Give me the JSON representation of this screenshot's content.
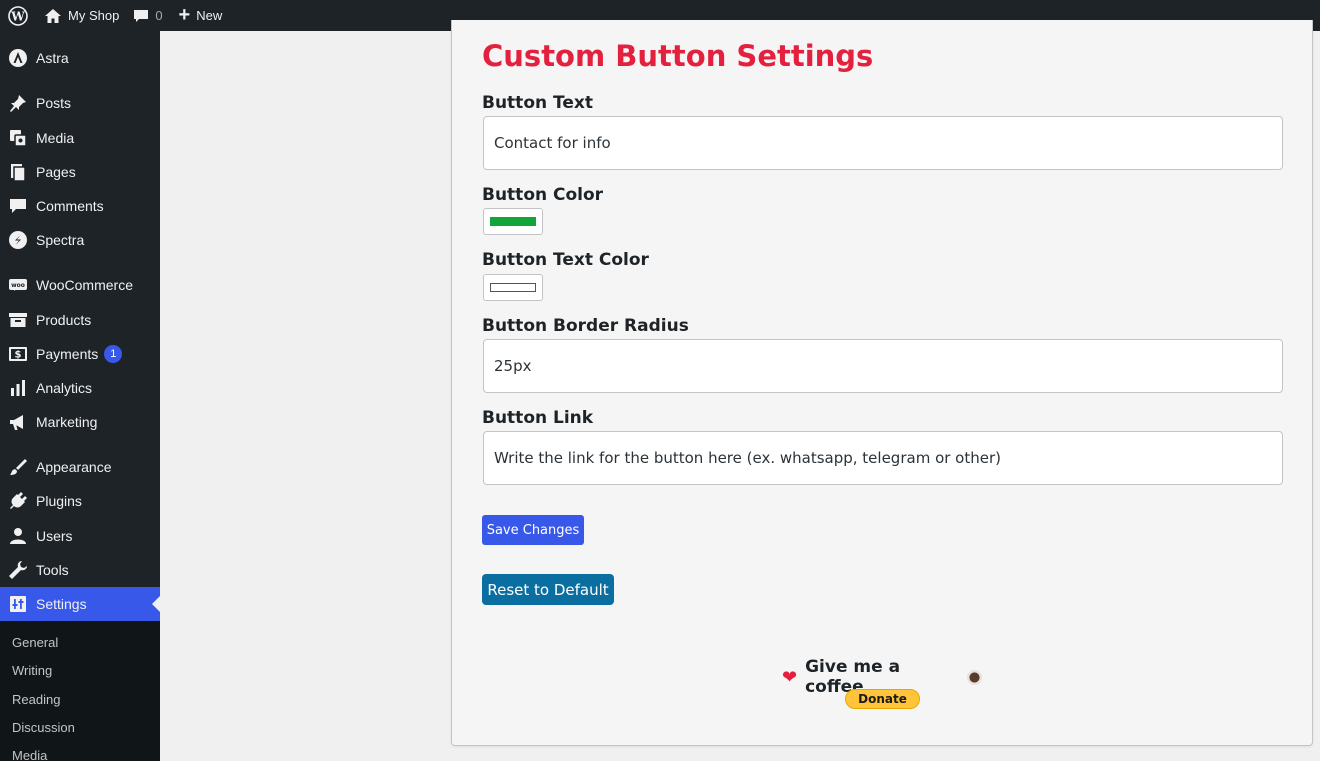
{
  "adminbar": {
    "site_name": "My Shop",
    "comments_count": "0",
    "new_label": "New"
  },
  "menu": {
    "items": [
      {
        "label": "Astra",
        "icon": "astra-icon"
      },
      {
        "label": "Posts",
        "icon": "pin-icon"
      },
      {
        "label": "Media",
        "icon": "media-icon"
      },
      {
        "label": "Pages",
        "icon": "pages-icon"
      },
      {
        "label": "Comments",
        "icon": "comment-icon"
      },
      {
        "label": "Spectra",
        "icon": "spectra-icon"
      },
      {
        "label": "WooCommerce",
        "icon": "woo-icon"
      },
      {
        "label": "Products",
        "icon": "archive-icon"
      },
      {
        "label": "Payments",
        "icon": "payments-icon",
        "badge": "1"
      },
      {
        "label": "Analytics",
        "icon": "chart-icon"
      },
      {
        "label": "Marketing",
        "icon": "megaphone-icon"
      },
      {
        "label": "Appearance",
        "icon": "brush-icon"
      },
      {
        "label": "Plugins",
        "icon": "plug-icon"
      },
      {
        "label": "Users",
        "icon": "user-icon"
      },
      {
        "label": "Tools",
        "icon": "wrench-icon"
      },
      {
        "label": "Settings",
        "icon": "settings-icon",
        "current": true
      }
    ],
    "submenu": [
      "General",
      "Writing",
      "Reading",
      "Discussion",
      "Media"
    ]
  },
  "page": {
    "title": "Custom Button Settings",
    "fields": {
      "button_text": {
        "label": "Button Text",
        "value": "Contact for info"
      },
      "button_color": {
        "label": "Button Color",
        "value": "#13a538"
      },
      "button_text_color": {
        "label": "Button Text Color",
        "value": "#ffffff"
      },
      "border_radius": {
        "label": "Button Border Radius",
        "value": "25px"
      },
      "button_link": {
        "label": "Button Link",
        "placeholder": "Write the link for the button here (ex. whatsapp, telegram or other)"
      }
    },
    "save_label": "Save Changes",
    "reset_label": "Reset to Default",
    "coffee_text": "Give me a coffee",
    "donate_label": "Donate"
  },
  "colors": {
    "accent": "#3858e9",
    "title": "#e3213f",
    "reset": "#0a6fa0",
    "donate": "#ffc439"
  }
}
